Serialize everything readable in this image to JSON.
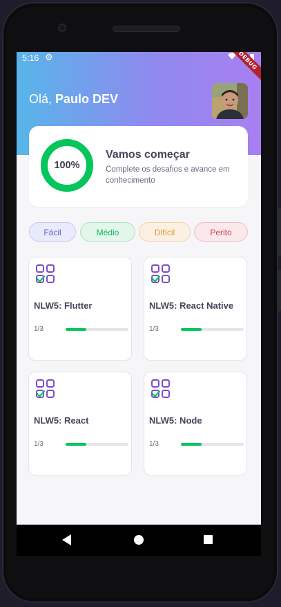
{
  "status": {
    "time": "5:16",
    "debug_label": "DEBUG"
  },
  "header": {
    "greeting_prefix": "Olá, ",
    "user_name": "Paulo DEV"
  },
  "score": {
    "percent_label": "100%",
    "percent": 100,
    "title": "Vamos começar",
    "subtitle": "Complete os desafios e avance em conhecimento",
    "ring_color": "#04c65a"
  },
  "levels": [
    {
      "label": "Fácil",
      "text_color": "#5f63c9",
      "bg_color": "#e9eafb",
      "border_color": "#c5c7f3"
    },
    {
      "label": "Médio",
      "text_color": "#12b25a",
      "bg_color": "#e3f6ea",
      "border_color": "#a9e3c1"
    },
    {
      "label": "Difícil",
      "text_color": "#e09b3c",
      "bg_color": "#fbf0e2",
      "border_color": "#f1d1a8"
    },
    {
      "label": "Perito",
      "text_color": "#c9434f",
      "bg_color": "#fbe8ea",
      "border_color": "#efbcc1"
    }
  ],
  "quizzes": [
    {
      "title": "NLW5: Flutter",
      "progress_label": "1/3",
      "progress": 0.333
    },
    {
      "title": "NLW5: React Native",
      "progress_label": "1/3",
      "progress": 0.333
    },
    {
      "title": "NLW5: React",
      "progress_label": "1/3",
      "progress": 0.333
    },
    {
      "title": "NLW5: Node",
      "progress_label": "1/3",
      "progress": 0.333
    }
  ],
  "colors": {
    "accent": "#8f8aee",
    "progress": "#04c65a",
    "icon_purple": "#7b4cc9",
    "icon_green": "#04c65a"
  },
  "icons": {
    "quiz": "quiz-grid-check-icon",
    "settings": "gear-icon"
  }
}
